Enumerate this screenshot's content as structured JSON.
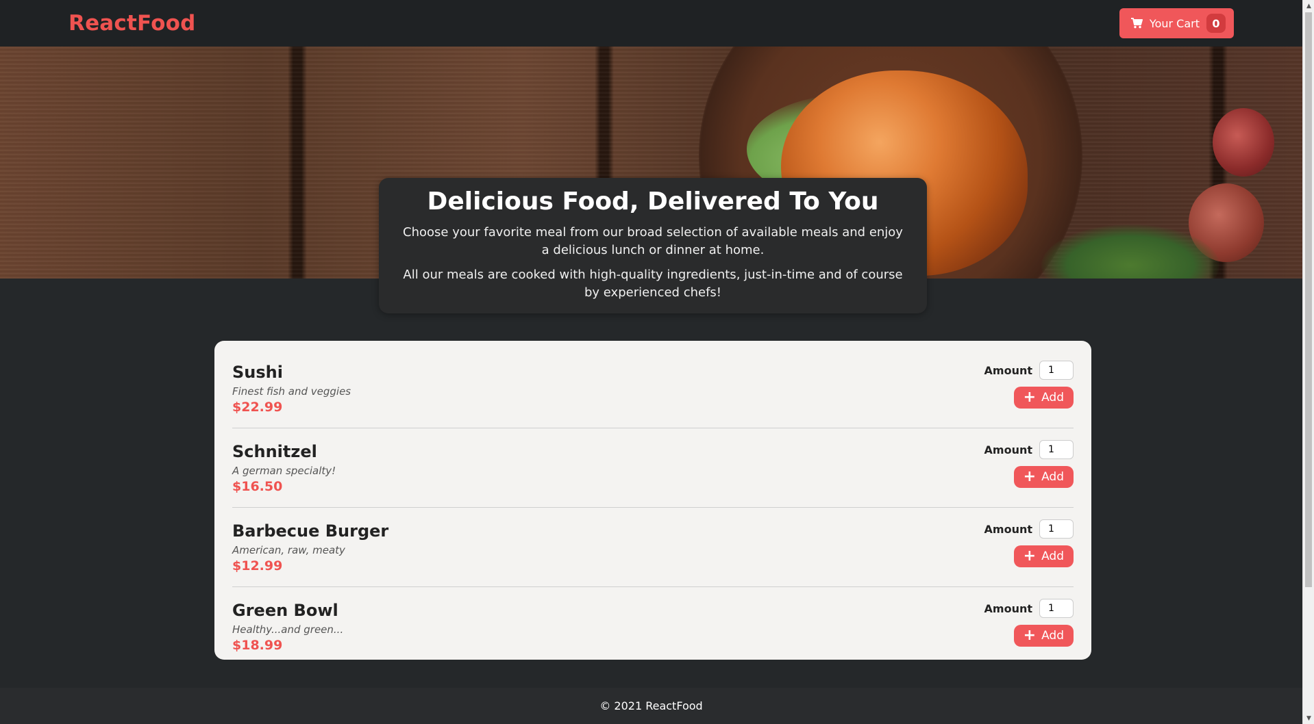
{
  "header": {
    "brand": "ReactFood",
    "cart_label": "Your Cart",
    "cart_count": "0"
  },
  "hero": {
    "title": "Delicious Food, Delivered To You",
    "paragraph1": "Choose your favorite meal from our broad selection of available meals and enjoy a delicious lunch or dinner at home.",
    "paragraph2": "All our meals are cooked with high-quality ingredients, just-in-time and of course by experienced chefs!"
  },
  "meals": [
    {
      "name": "Sushi",
      "description": "Finest fish and veggies",
      "price": "$22.99",
      "amount_label": "Amount",
      "amount_value": "1",
      "add_label": "Add"
    },
    {
      "name": "Schnitzel",
      "description": "A german specialty!",
      "price": "$16.50",
      "amount_label": "Amount",
      "amount_value": "1",
      "add_label": "Add"
    },
    {
      "name": "Barbecue Burger",
      "description": "American, raw, meaty",
      "price": "$12.99",
      "amount_label": "Amount",
      "amount_value": "1",
      "add_label": "Add"
    },
    {
      "name": "Green Bowl",
      "description": "Healthy...and green...",
      "price": "$18.99",
      "amount_label": "Amount",
      "amount_value": "1",
      "add_label": "Add"
    }
  ],
  "footer": {
    "text": "© 2021 ReactFood"
  },
  "icons": {
    "cart": "shopping-cart-icon",
    "plus": "plus-icon"
  },
  "colors": {
    "accent": "#f0575a",
    "brand": "#ef5350",
    "background": "#25282a"
  }
}
